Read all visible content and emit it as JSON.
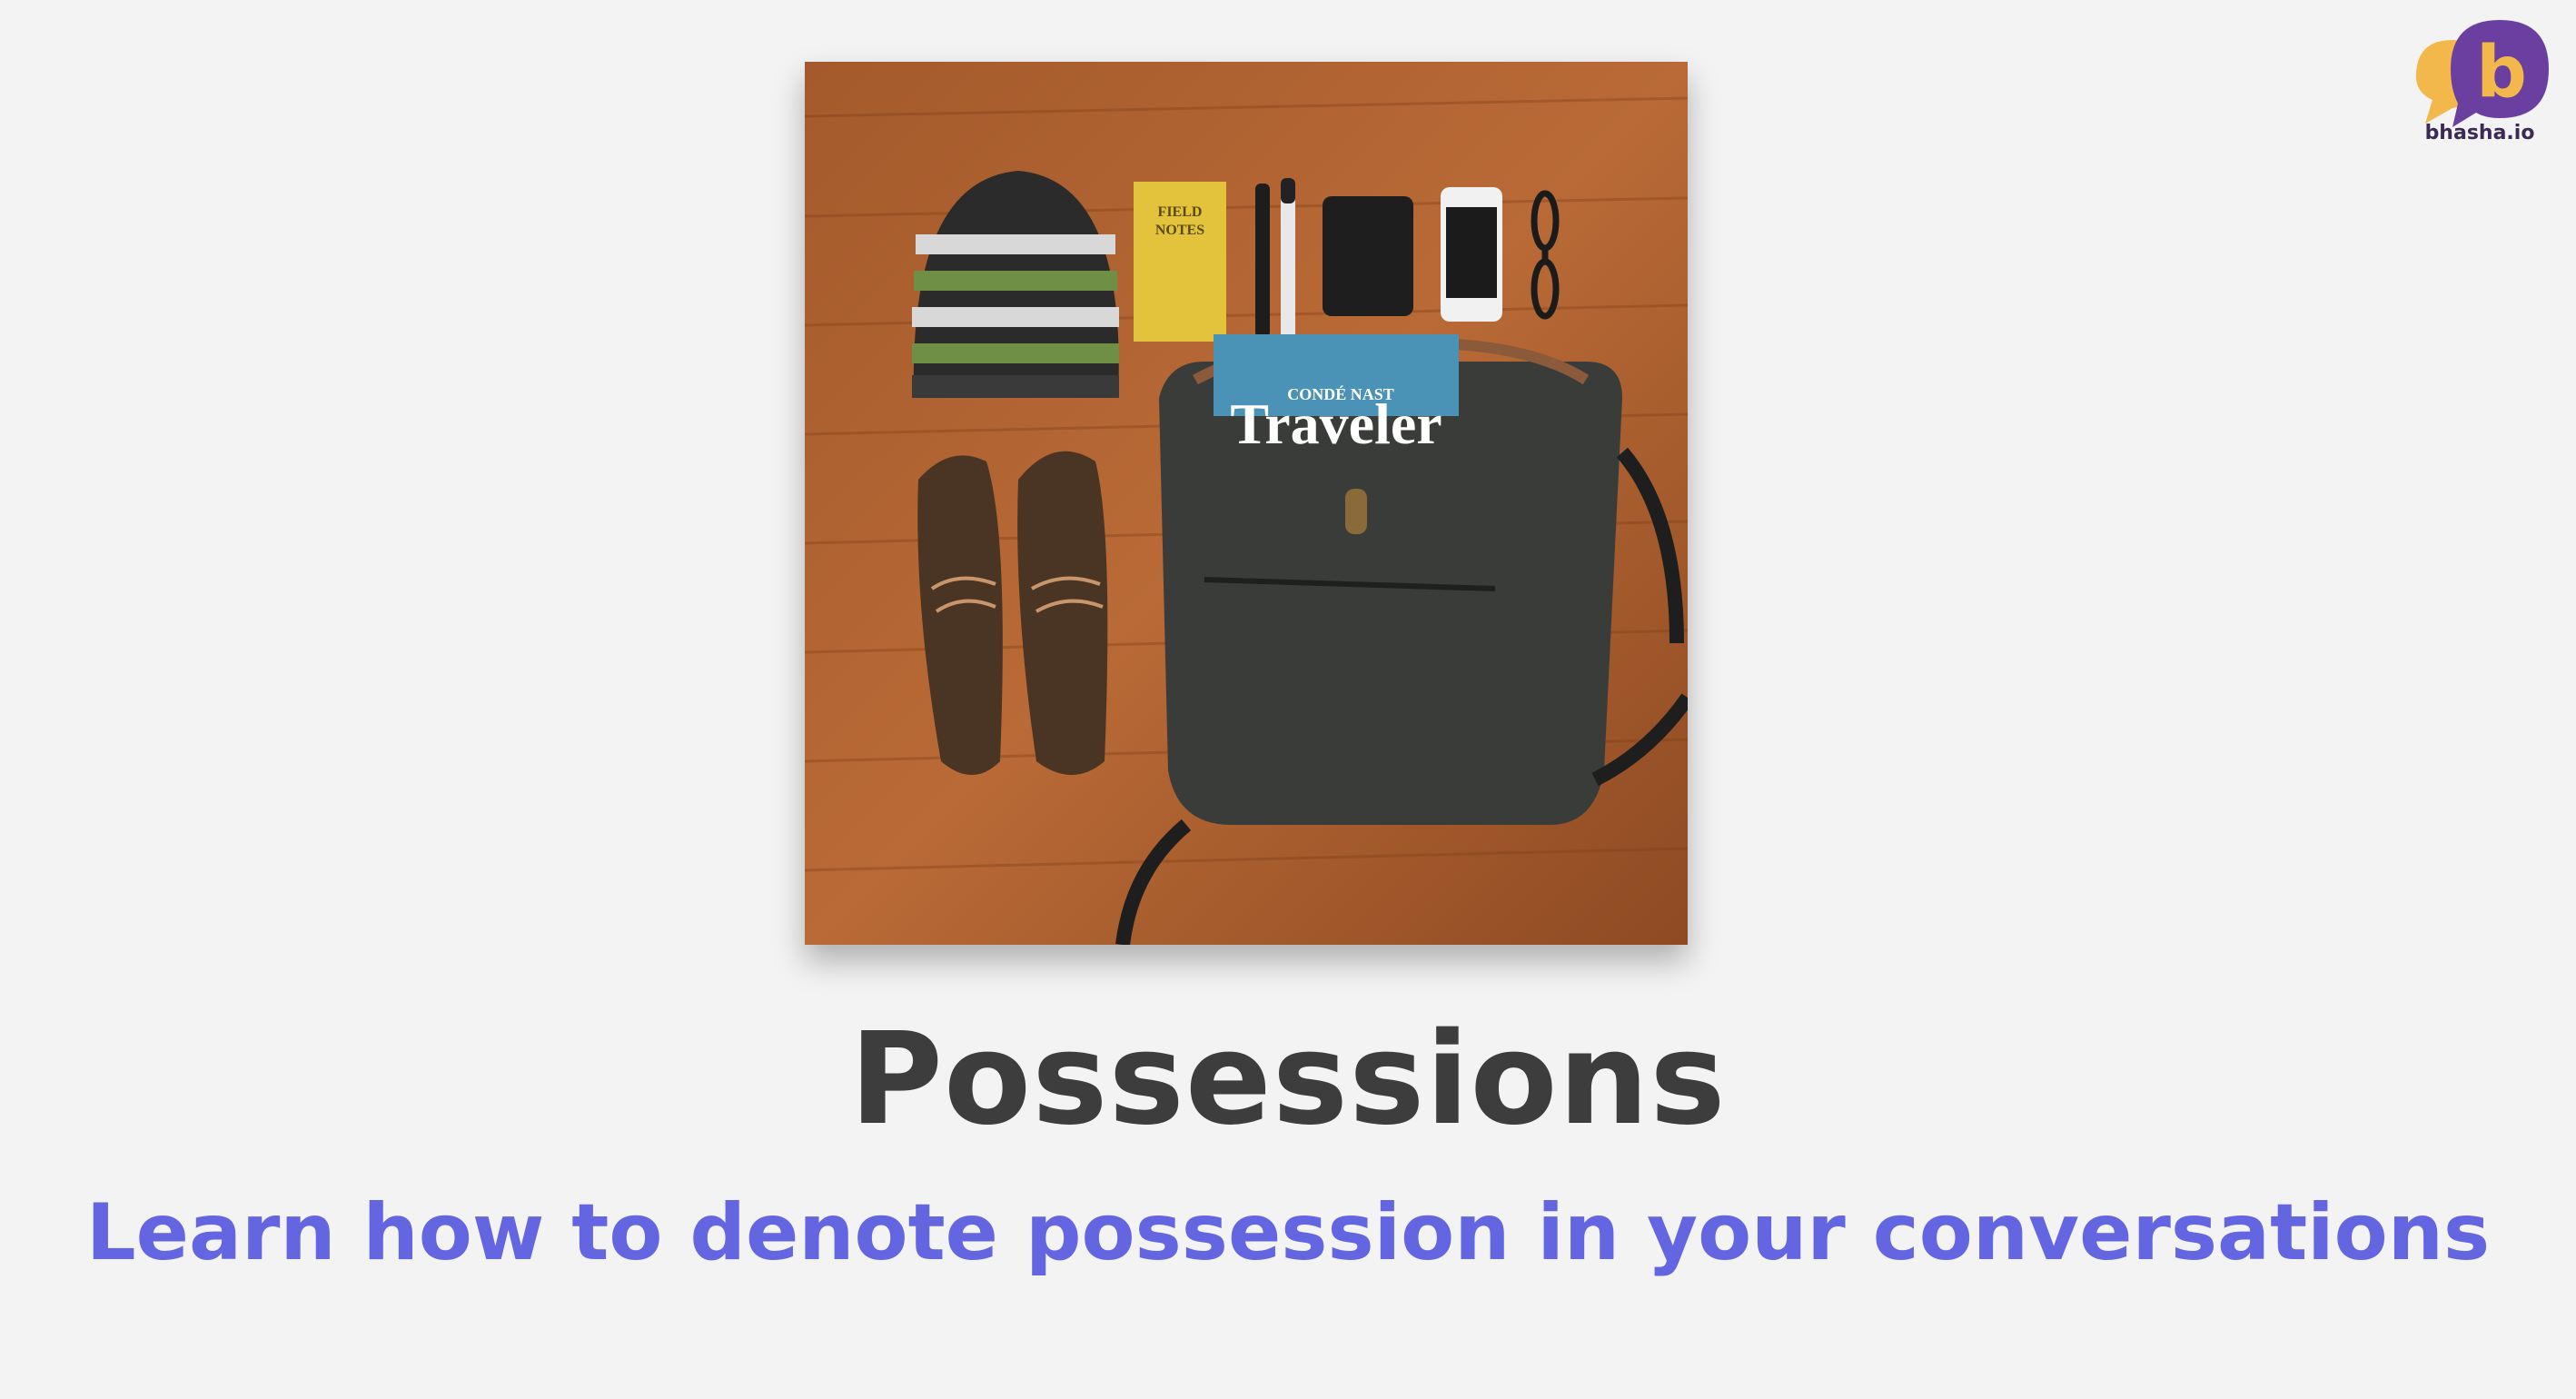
{
  "brand": {
    "name": "bhasha.io",
    "mark": "b"
  },
  "lesson": {
    "title": "Possessions",
    "subtitle": "Learn how to denote possession in your conversations"
  },
  "photo_labels": {
    "notebook_line1": "FIELD",
    "notebook_line2": "NOTES",
    "magazine_top": "CONDÉ NAST",
    "magazine_title": "Traveler"
  },
  "colors": {
    "background": "#f3f3f3",
    "title": "#3d3d3d",
    "subtitle": "#6366e0",
    "brand_purple": "#6b3fa0",
    "brand_yellow": "#f2b84b"
  }
}
